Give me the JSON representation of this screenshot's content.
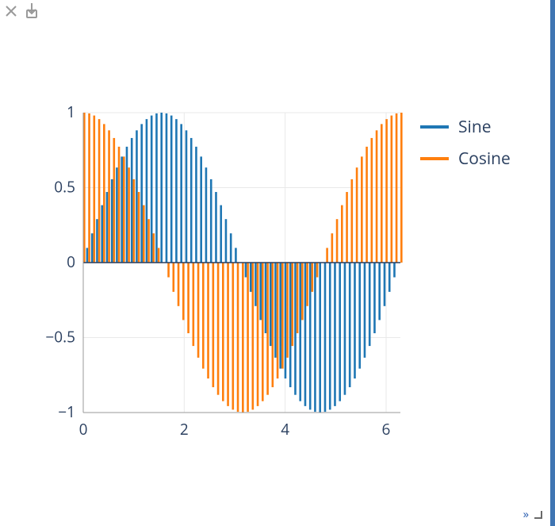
{
  "toolbar": {
    "close_label": "close",
    "download_label": "download"
  },
  "footer": {
    "expand_label": "expand",
    "resize_label": "resize-handle"
  },
  "legend": {
    "entries": [
      {
        "name": "Sine",
        "color": "#1f77b4"
      },
      {
        "name": "Cosine",
        "color": "#ff7f0e"
      }
    ]
  },
  "axis": {
    "x_ticks": [
      "0",
      "2",
      "4",
      "6"
    ],
    "y_ticks": [
      "1",
      "0.5",
      "0",
      "−0.5",
      "−1"
    ]
  },
  "chart_data": {
    "type": "bar",
    "title": "",
    "xlabel": "",
    "ylabel": "",
    "xlim": [
      0,
      6.283
    ],
    "ylim": [
      -1,
      1
    ],
    "x": [
      0,
      0.098,
      0.196,
      0.295,
      0.393,
      0.491,
      0.589,
      0.687,
      0.785,
      0.884,
      0.982,
      1.08,
      1.178,
      1.276,
      1.374,
      1.473,
      1.571,
      1.669,
      1.767,
      1.865,
      1.963,
      2.062,
      2.16,
      2.258,
      2.356,
      2.454,
      2.553,
      2.651,
      2.749,
      2.847,
      2.945,
      3.043,
      3.142,
      3.24,
      3.338,
      3.436,
      3.534,
      3.633,
      3.731,
      3.829,
      3.927,
      4.025,
      4.123,
      4.222,
      4.32,
      4.418,
      4.516,
      4.614,
      4.712,
      4.811,
      4.909,
      5.007,
      5.105,
      5.203,
      5.301,
      5.4,
      5.498,
      5.596,
      5.694,
      5.792,
      5.89,
      5.989,
      6.087,
      6.185,
      6.283
    ],
    "series": [
      {
        "name": "Sine",
        "color": "#1f77b4",
        "values": [
          0,
          0.098,
          0.195,
          0.29,
          0.383,
          0.471,
          0.556,
          0.634,
          0.707,
          0.773,
          0.831,
          0.882,
          0.924,
          0.957,
          0.981,
          0.995,
          1,
          0.995,
          0.981,
          0.957,
          0.924,
          0.882,
          0.831,
          0.773,
          0.707,
          0.634,
          0.556,
          0.471,
          0.383,
          0.29,
          0.195,
          0.098,
          0,
          -0.098,
          -0.195,
          -0.29,
          -0.383,
          -0.471,
          -0.556,
          -0.634,
          -0.707,
          -0.773,
          -0.831,
          -0.882,
          -0.924,
          -0.957,
          -0.981,
          -0.995,
          -1,
          -0.995,
          -0.981,
          -0.957,
          -0.924,
          -0.882,
          -0.831,
          -0.773,
          -0.707,
          -0.634,
          -0.556,
          -0.471,
          -0.383,
          -0.29,
          -0.195,
          -0.098,
          0
        ]
      },
      {
        "name": "Cosine",
        "color": "#ff7f0e",
        "values": [
          1,
          0.995,
          0.981,
          0.957,
          0.924,
          0.882,
          0.831,
          0.773,
          0.707,
          0.634,
          0.556,
          0.471,
          0.383,
          0.29,
          0.195,
          0.098,
          0,
          -0.098,
          -0.195,
          -0.29,
          -0.383,
          -0.471,
          -0.556,
          -0.634,
          -0.707,
          -0.773,
          -0.831,
          -0.882,
          -0.924,
          -0.957,
          -0.981,
          -0.995,
          -1,
          -0.995,
          -0.981,
          -0.957,
          -0.924,
          -0.882,
          -0.831,
          -0.773,
          -0.707,
          -0.634,
          -0.556,
          -0.471,
          -0.383,
          -0.29,
          -0.195,
          -0.098,
          0,
          0.098,
          0.195,
          0.29,
          0.383,
          0.471,
          0.556,
          0.634,
          0.707,
          0.773,
          0.831,
          0.882,
          0.924,
          0.957,
          0.981,
          0.995,
          1
        ]
      }
    ],
    "legend_position": "right",
    "grid": true
  }
}
